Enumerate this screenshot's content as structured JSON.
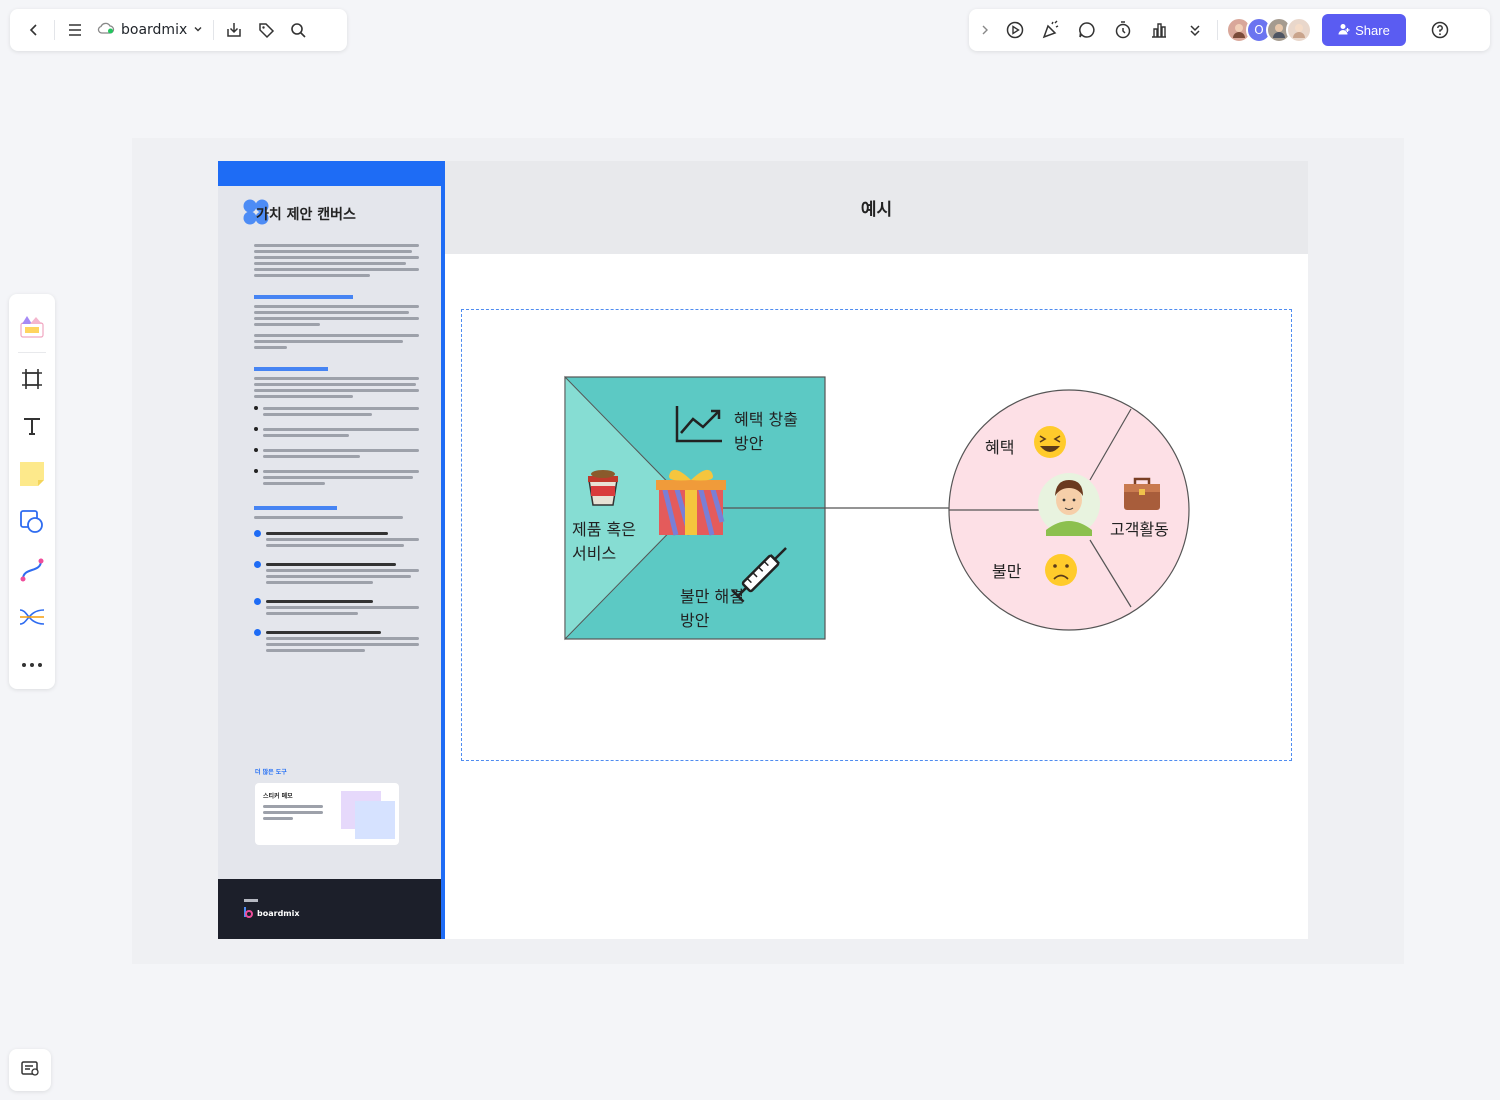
{
  "app": {
    "brand_name": "boardmix",
    "share_label": "Share",
    "collaborator_initial": "O"
  },
  "guide": {
    "title": "가치 제안 캔버스",
    "more_tools": "더 많은 도구",
    "sticky_card_title": "스티커 메모",
    "footer_brand": "boardmix"
  },
  "example": {
    "title": "예시",
    "labels": {
      "gain_creators": "혜택 창출",
      "gain_creators_2": "방안",
      "products_services": "제품 혹은",
      "products_services_2": "서비스",
      "pain_relievers": "불만 해결",
      "pain_relievers_2": "방안",
      "gains": "혜택",
      "pains": "불만",
      "customer_jobs": "고객활동"
    }
  },
  "colors": {
    "accent": "#5a5cf2",
    "guide_blue": "#1e6cf5",
    "teal": "#5cc9c4",
    "teal_light": "#86ddd3",
    "pink": "#fde0e6"
  }
}
